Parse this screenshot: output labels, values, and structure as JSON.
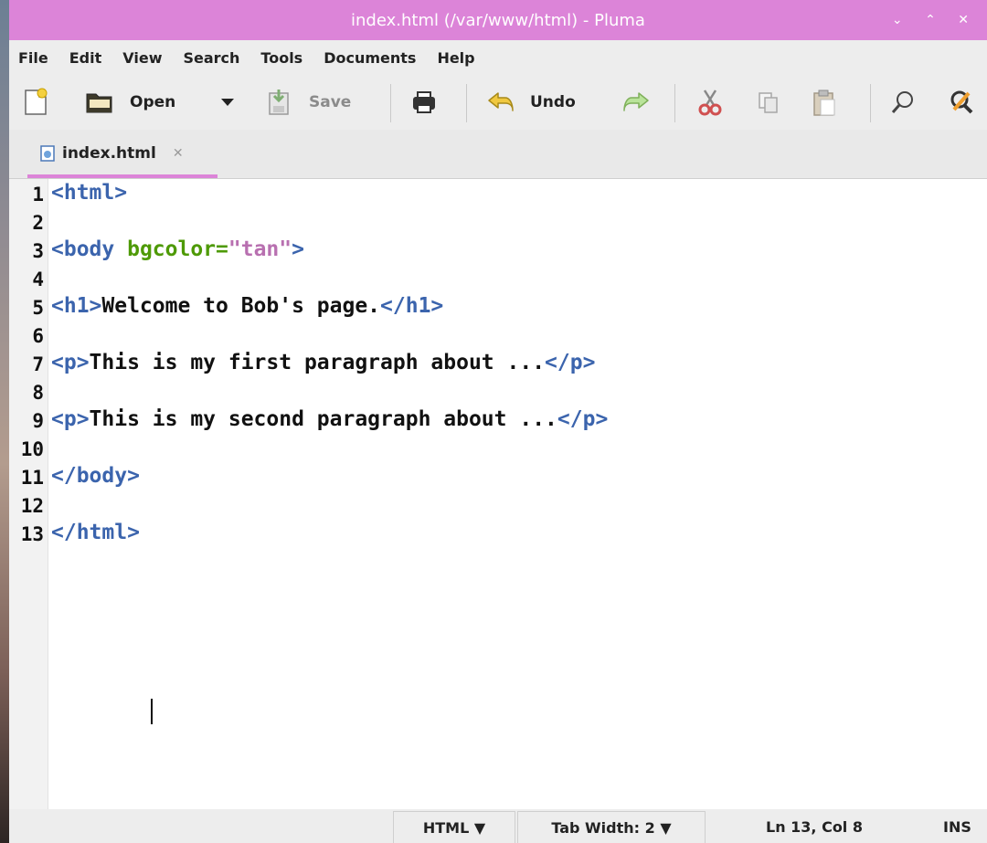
{
  "window": {
    "title": "index.html (/var/www/html) - Pluma",
    "controls": "⌄ ⌃ ✕"
  },
  "menu": [
    "File",
    "Edit",
    "View",
    "Search",
    "Tools",
    "Documents",
    "Help"
  ],
  "toolbar": {
    "open_label": "Open",
    "save_label": "Save",
    "undo_label": "Undo"
  },
  "tab": {
    "label": "index.html",
    "close": "✕"
  },
  "editor": {
    "line_numbers": [
      "1",
      "2",
      "3",
      "4",
      "5",
      "6",
      "7",
      "8",
      "9",
      "10",
      "11",
      "12",
      "13"
    ],
    "lines": [
      "<html>",
      "",
      "<body bgcolor=\"tan\">",
      "",
      "<h1>Welcome to Bob's page.</h1>",
      "",
      "<p>This is my first paragraph about ...</p>",
      "",
      "<p>This is my second paragraph about ...</p>",
      "",
      "</body>",
      "",
      "</html>"
    ]
  },
  "status": {
    "language": "HTML ▼",
    "tab_width": "Tab Width: 2 ▼",
    "position": "Ln 13, Col 8",
    "mode": "INS"
  },
  "colors": {
    "titlebar": "#dc84d8",
    "tag": "#3b64ad",
    "attr": "#4e9a06",
    "string": "#b870b0"
  }
}
